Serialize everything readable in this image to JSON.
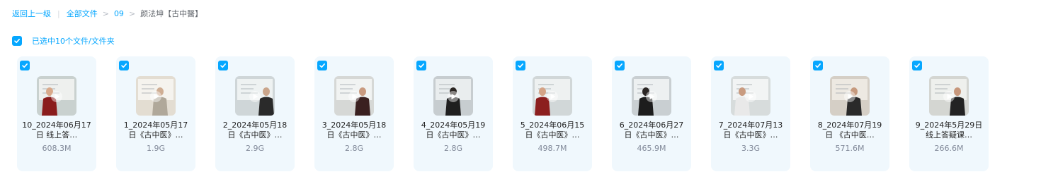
{
  "breadcrumb": {
    "back": "返回上一级",
    "all_files": "全部文件",
    "folder": "09",
    "current": "颜法坤【古中醫】"
  },
  "selection": {
    "text": "已选中10个文件/文件夹"
  },
  "colors": {
    "accent": "#06a7ff",
    "card_bg": "#f0f8fd",
    "size_text": "#818999"
  },
  "files": [
    {
      "name": "10_2024年06月17日 线上答…",
      "size": "608.3M",
      "checked": true,
      "icon": "video-thumbnail"
    },
    {
      "name": "1_2024年05月17日《古中医》…",
      "size": "1.9G",
      "checked": true,
      "icon": "video-thumbnail"
    },
    {
      "name": "2_2024年05月18日《古中医》…",
      "size": "2.9G",
      "checked": true,
      "icon": "video-thumbnail"
    },
    {
      "name": "3_2024年05月18日《古中医》…",
      "size": "2.8G",
      "checked": true,
      "icon": "video-thumbnail"
    },
    {
      "name": "4_2024年05月19日《古中医》…",
      "size": "2.8G",
      "checked": true,
      "icon": "video-thumbnail"
    },
    {
      "name": "5_2024年06月15日《古中医》…",
      "size": "498.7M",
      "checked": true,
      "icon": "video-thumbnail"
    },
    {
      "name": "6_2024年06月27日《古中医》…",
      "size": "465.9M",
      "checked": true,
      "icon": "video-thumbnail"
    },
    {
      "name": "7_2024年07月13日《古中医》…",
      "size": "3.3G",
      "checked": true,
      "icon": "video-thumbnail"
    },
    {
      "name": "8_2024年07月19日 《古中医…",
      "size": "571.6M",
      "checked": true,
      "icon": "video-thumbnail"
    },
    {
      "name": "9_2024年5月29日 线上答疑课…",
      "size": "266.6M",
      "checked": true,
      "icon": "video-thumbnail"
    }
  ]
}
